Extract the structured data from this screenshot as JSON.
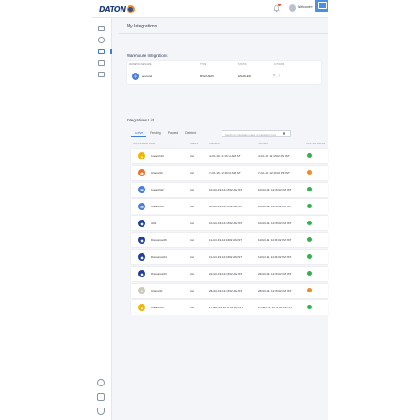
{
  "app": {
    "logo_text": "DATON",
    "user_name": "Welcome",
    "page_title": "My Integrations"
  },
  "icons": {
    "topbar": [
      "bell-icon",
      "avatar-icon",
      "chat-icon"
    ],
    "sidebar": [
      "dashboard-icon",
      "clock-icon",
      "integrations-icon",
      "reports-icon",
      "settings-icon"
    ],
    "sidebar_bottom": [
      "help-icon",
      "bulb-icon",
      "shield-icon"
    ]
  },
  "warehouse": {
    "title": "Warehouse Integrations",
    "headers": [
      "WAREHOUSE NAME",
      "TYPE",
      "STATUS",
      "ACTIONS"
    ],
    "rows": [
      {
        "name": "accoutell",
        "type": "BIGQUERY",
        "status": "ENABLED"
      }
    ]
  },
  "integrations": {
    "title": "Integrations List",
    "tabs": [
      "Active",
      "Pending",
      "Paused",
      "Deleted"
    ],
    "active_tab": "Active",
    "search_placeholder": "Search by Integration name or Integration type",
    "headers": [
      "INTEGRATION NAME",
      "OWNER",
      "CREATED",
      "UPDATED",
      "LAST JOB STATUS"
    ],
    "rows": [
      {
        "name": "Gsearch34",
        "owner": "test",
        "created": "4-Oct-19, 11:16:14 AM IST",
        "updated": "4-Oct-19, 11:16:02 PM IST",
        "status": "ok",
        "icon": "adwords-icon",
        "icon_color": "#f4b400"
      },
      {
        "name": "Ctransit02",
        "owner": "test",
        "created": "7-Oct-19, 12:16:02 AM IST",
        "updated": "7-Oct-19, 12:16:02 PM IST",
        "status": "warn",
        "icon": "target-icon",
        "icon_color": "#f07027"
      },
      {
        "name": "Gsearch02",
        "owner": "test",
        "created": "10-Oct-19, 12:16:02 AM IST",
        "updated": "10-Oct-19, 12:16:02 PM IST",
        "status": "ok",
        "icon": "gmail-icon",
        "icon_color": "#4a7cdc"
      },
      {
        "name": "Gsearch03",
        "owner": "test",
        "created": "10-Oct-19, 12:16:02 AM IST",
        "updated": "10-Oct-19, 12:16:02 PM IST",
        "status": "ok",
        "icon": "gmail-icon",
        "icon_color": "#4a7cdc"
      },
      {
        "name": "tst01",
        "owner": "test",
        "created": "10-Oct-19, 12:16:02 AM IST",
        "updated": "10-Oct-19, 12:16:02 PM IST",
        "status": "ok",
        "icon": "dropbox-icon",
        "icon_color": "#1e3f9a"
      },
      {
        "name": "Dbssource06",
        "owner": "test",
        "created": "11-Oct-19, 12:16:02 AM IST",
        "updated": "11-Oct-19, 12:16:02 PM IST",
        "status": "ok",
        "icon": "dropbox-icon",
        "icon_color": "#1e3f9a"
      },
      {
        "name": "Dbssource04",
        "owner": "test",
        "created": "11-Oct-19, 12:16:02 AM IST",
        "updated": "11-Oct-19, 12:16:02 PM IST",
        "status": "ok",
        "icon": "dropbox-icon",
        "icon_color": "#1e3f9a"
      },
      {
        "name": "Dbssource03",
        "owner": "test",
        "created": "22-Oct-19, 12:16:02 AM IST",
        "updated": "22-Oct-19, 12:16:02 PM IST",
        "status": "ok",
        "icon": "dropbox-icon",
        "icon_color": "#1e3f9a"
      },
      {
        "name": "Ctransit01",
        "owner": "test",
        "created": "26-Oct-19, 12:16:02 AM IST",
        "updated": "26-Oct-19, 12:16:02 PM IST",
        "status": "warn",
        "icon": "logo-icon",
        "icon_color": "#c9c9b8"
      },
      {
        "name": "Gsearch04",
        "owner": "test",
        "created": "27-Nov-19, 12:16:02 AM IST",
        "updated": "27-Nov-19, 12:16:02 PM IST",
        "status": "ok",
        "icon": "adwords-icon",
        "icon_color": "#f4b400"
      }
    ]
  },
  "colors": {
    "accent": "#3b7ddd",
    "ok": "#2fb34a",
    "warn": "#f08a24"
  }
}
